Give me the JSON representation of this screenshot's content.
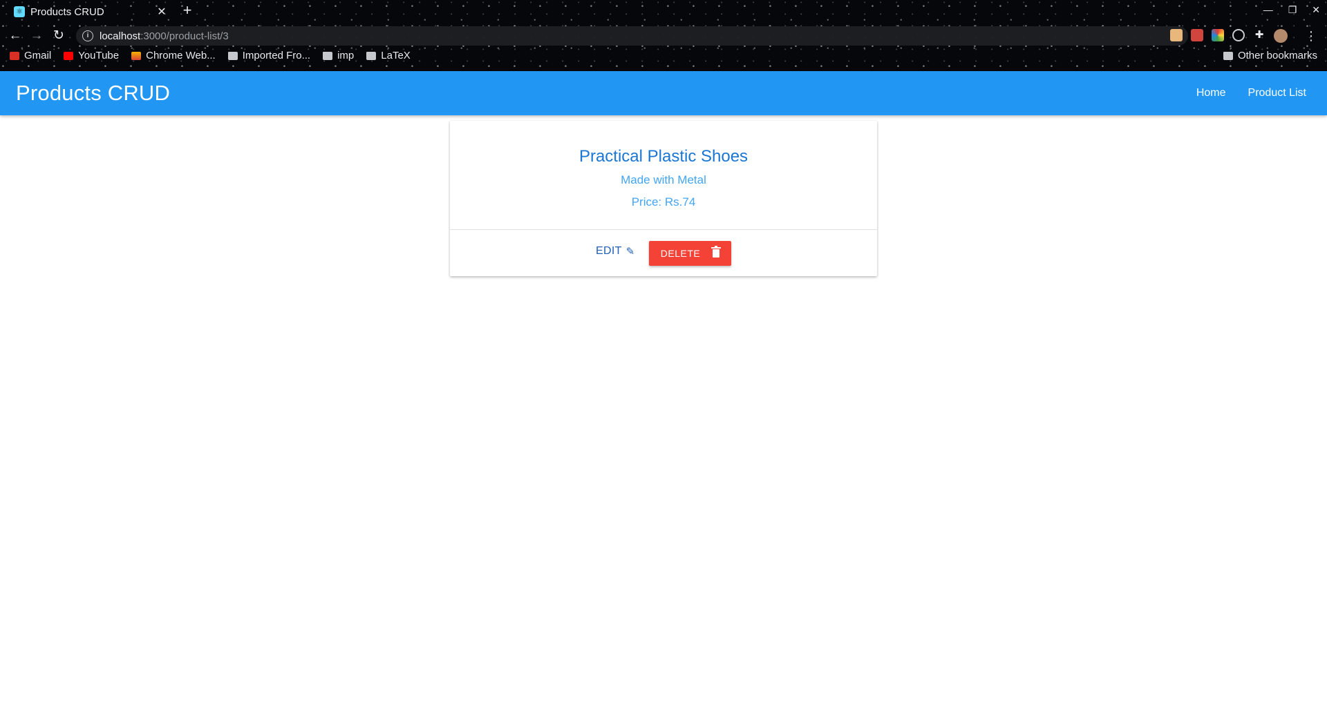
{
  "browser": {
    "tab_title": "Products CRUD",
    "tab_close": "✕",
    "new_tab": "+",
    "url_host": "localhost",
    "url_path": ":3000/product-list/3",
    "bookmarks": [
      {
        "label": "Gmail",
        "icon": "gmail-icon",
        "color": "#d93025"
      },
      {
        "label": "YouTube",
        "icon": "youtube-icon",
        "color": "#ff0000"
      },
      {
        "label": "Chrome Web...",
        "icon": "chrome-web-store-icon",
        "color": "#f4b400"
      },
      {
        "label": "Imported Fro...",
        "icon": "folder-icon",
        "color": "#c5c8cc"
      },
      {
        "label": "imp",
        "icon": "folder-icon",
        "color": "#c5c8cc"
      },
      {
        "label": "LaTeX",
        "icon": "folder-icon",
        "color": "#c5c8cc"
      }
    ],
    "other_bookmarks": "Other bookmarks"
  },
  "app": {
    "title": "Products CRUD",
    "nav": {
      "home": "Home",
      "product_list": "Product List"
    },
    "accent_color": "#2196f3"
  },
  "product": {
    "name": "Practical Plastic Shoes",
    "material": "Made with Metal",
    "price": "Price: Rs.74",
    "edit_label": "EDIT",
    "delete_label": "DELETE",
    "delete_color": "#f44336"
  }
}
